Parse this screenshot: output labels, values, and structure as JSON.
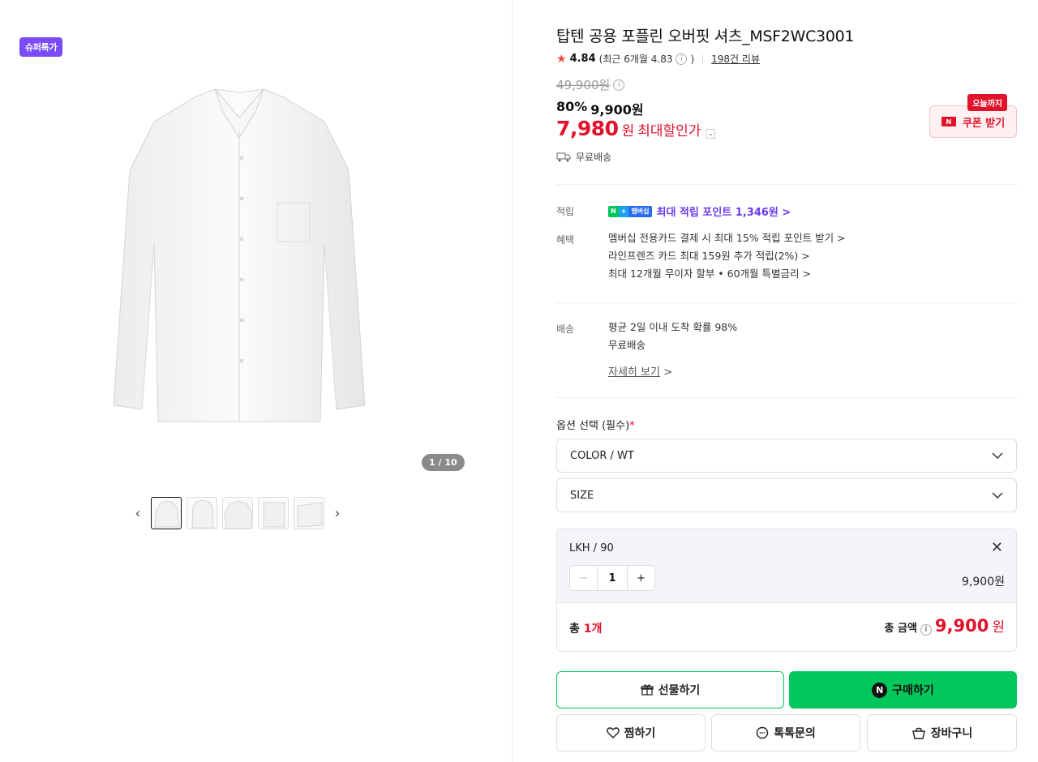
{
  "gallery": {
    "badge": "슈퍼특가",
    "counter_current": "1",
    "counter_total": "10",
    "counter_sep": "/",
    "prev_icon": "‹",
    "next_icon": "›"
  },
  "product": {
    "title": "탑텐 공용 포플린 오버핏 셔츠_MSF2WC3001",
    "rating": "4.84",
    "rating_recent": "(최근 6개월 4.83",
    "rating_recent_close": ")",
    "reviews": "198건 리뷰",
    "original_price": "49,900원",
    "discount_rate": "80%",
    "discount_price": "9,900원",
    "sale_price": "7,980",
    "sale_won": "원",
    "sale_label": "최대할인가",
    "shipping_badge": "무료배송"
  },
  "coupon": {
    "tag": "오늘까지",
    "icon_text": "N",
    "label": "쿠폰 받기"
  },
  "points": {
    "label": "적립",
    "badge_n": "N",
    "badge_plus": "+",
    "badge_member": "멤버십",
    "text": "최대 적립 포인트 1,346원 >"
  },
  "benefits": {
    "label": "혜택",
    "items": [
      "멤버십 전용카드 결제 시 최대 15% 적립 포인트 받기 >",
      "라인프렌즈 카드 최대 159원 추가 적립(2%) >",
      "최대 12개월 무이자 할부 • 60개월 특별금리 >"
    ]
  },
  "delivery": {
    "label": "배송",
    "line1": "평균 2일 이내 도착 확률 98%",
    "line2": "무료배송",
    "detail_link": "자세히 보기",
    "detail_arrow": ">"
  },
  "options": {
    "title": "옵션 선택 (필수)",
    "required_mark": "*",
    "color_select": "COLOR / WT",
    "size_select": "SIZE"
  },
  "selected": {
    "name": "LKH / 90",
    "quantity": "1",
    "price": "9,900원",
    "total_label": "총",
    "total_count": "1개",
    "total_amount_label": "총 금액",
    "total_amount": "9,900",
    "total_won": "원"
  },
  "actions": {
    "gift": "선물하기",
    "buy": "구매하기",
    "wish": "찜하기",
    "talk": "톡톡문의",
    "cart": "장바구니"
  }
}
